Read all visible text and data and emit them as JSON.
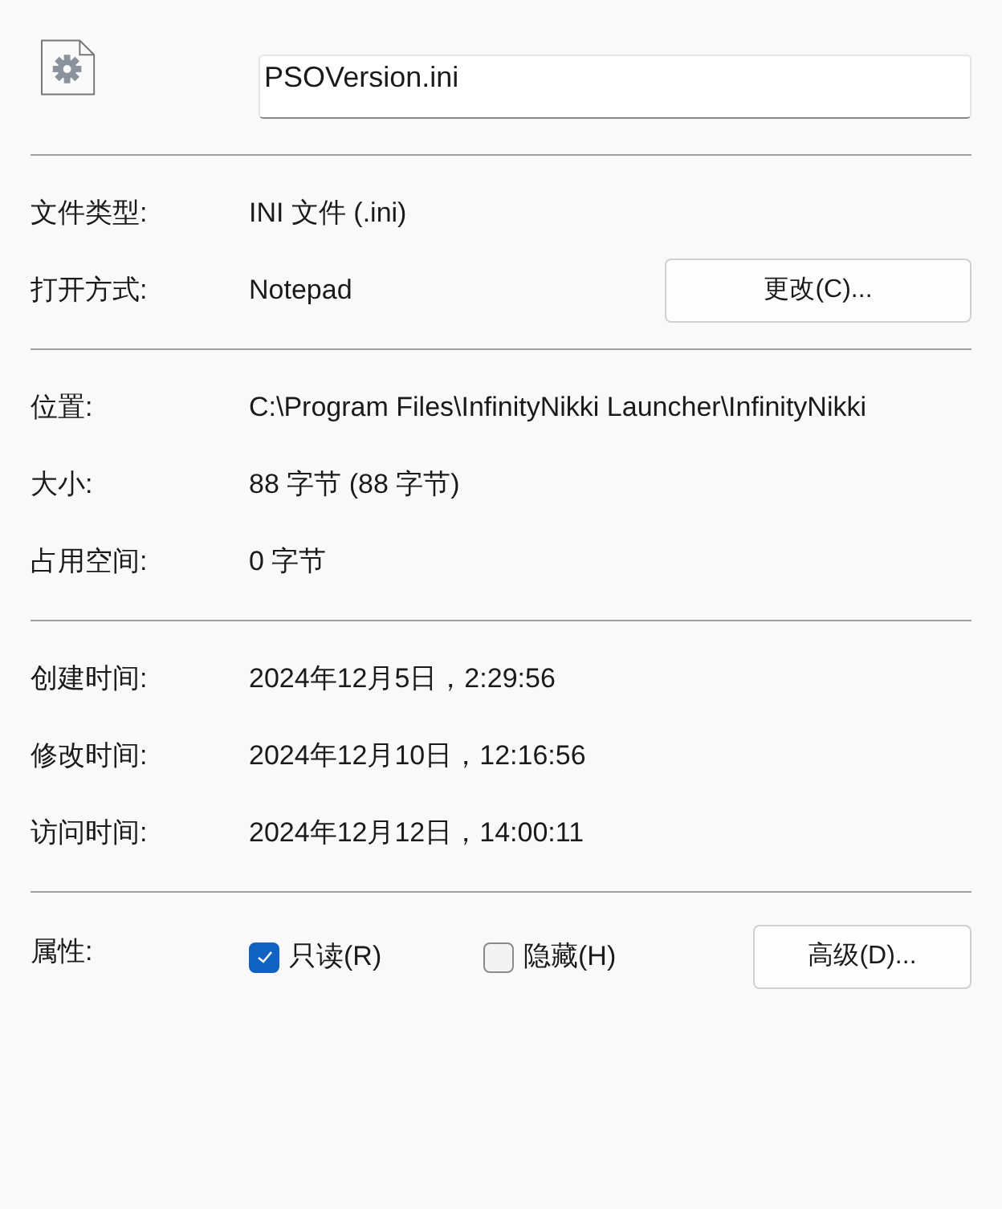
{
  "file_name": "PSOVersion.ini",
  "sections": [
    [
      {
        "label": "文件类型:",
        "value": "INI 文件 (.ini)"
      },
      {
        "label": "打开方式:",
        "value": "Notepad",
        "button": "更改(C)..."
      }
    ],
    [
      {
        "label": "位置:",
        "value": "C:\\Program Files\\InfinityNikki Launcher\\InfinityNikki"
      },
      {
        "label": "大小:",
        "value": "88 字节 (88 字节)"
      },
      {
        "label": "占用空间:",
        "value": "0 字节"
      }
    ],
    [
      {
        "label": "创建时间:",
        "value": "2024年12月5日，2:29:56"
      },
      {
        "label": "修改时间:",
        "value": "2024年12月10日，12:16:56"
      },
      {
        "label": "访问时间:",
        "value": "2024年12月12日，14:00:11"
      }
    ]
  ],
  "attributes": {
    "label": "属性:",
    "options": [
      {
        "label": "只读(R)",
        "checked": true
      },
      {
        "label": "隐藏(H)",
        "checked": false
      }
    ],
    "button": "高级(D)..."
  }
}
